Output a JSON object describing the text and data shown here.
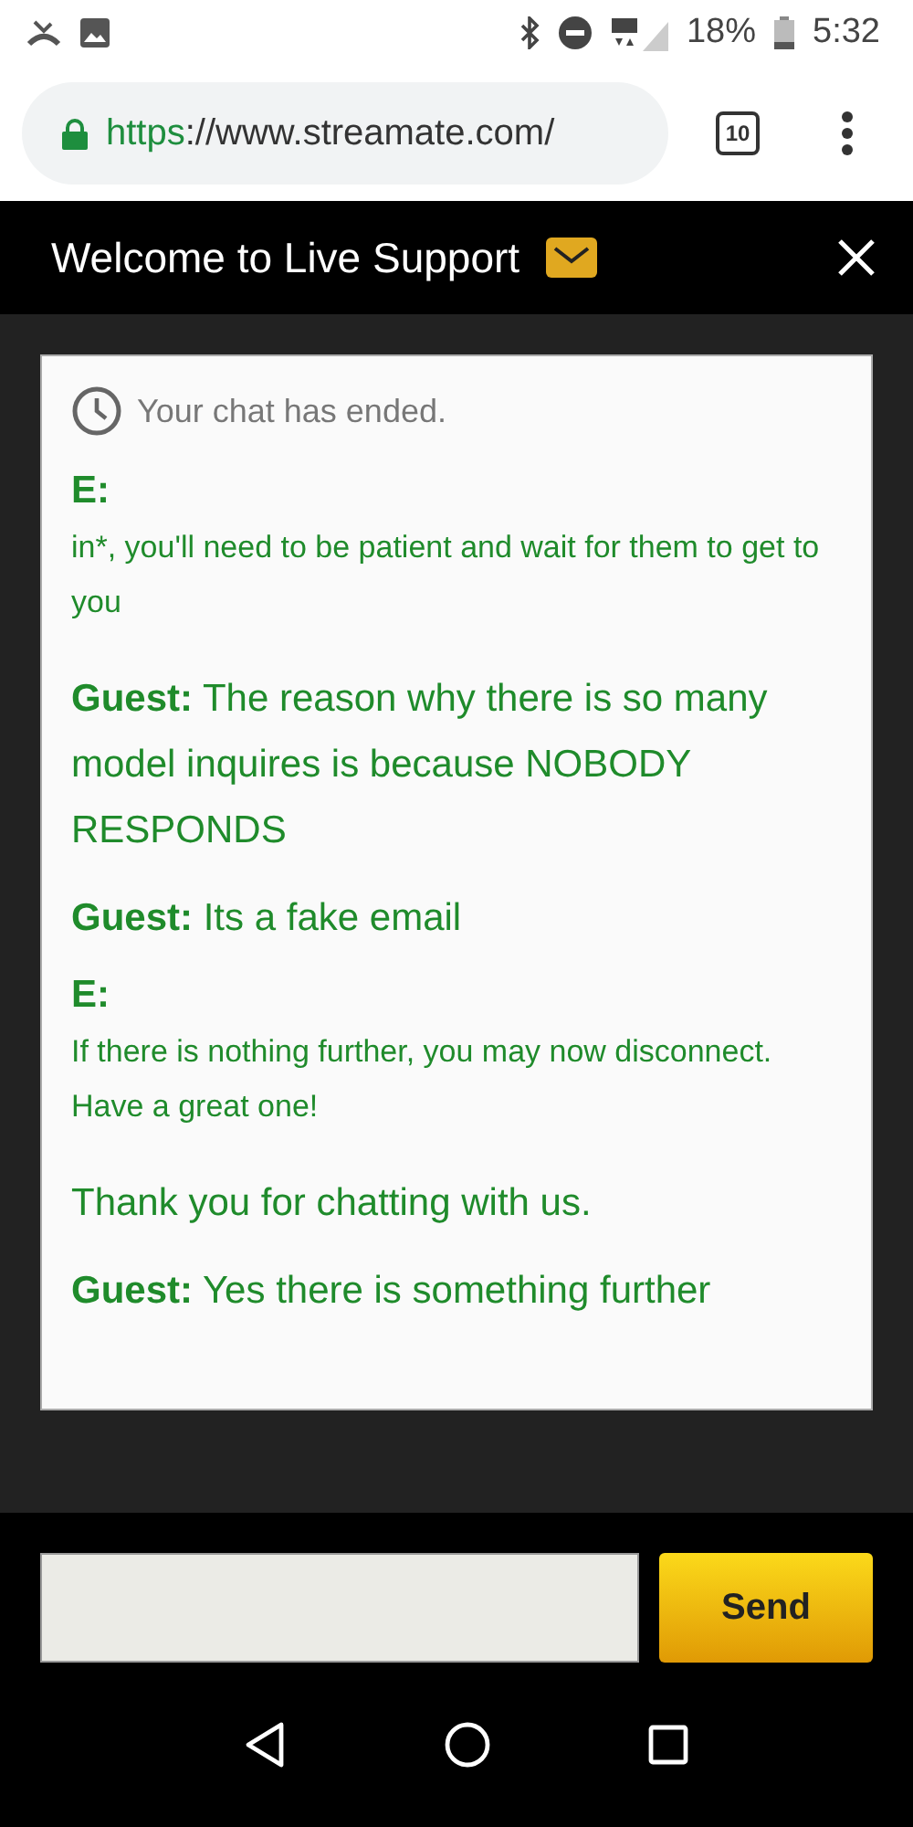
{
  "status_bar": {
    "battery": "18%",
    "time": "5:32"
  },
  "browser": {
    "url_scheme": "https",
    "url_rest": "://www.streamate.com/",
    "tab_count": "10"
  },
  "chat": {
    "title": "Welcome to Live Support",
    "messages": [
      {
        "kind": "system",
        "text": "Your chat has ended."
      },
      {
        "kind": "agent",
        "sender": "E:",
        "text": "in*, you'll need to be patient and wait for them to get to you"
      },
      {
        "kind": "guest",
        "sender": "Guest:",
        "text": "The reason why there is so many model inquires is because NOBODY RESPONDS"
      },
      {
        "kind": "guest",
        "sender": "Guest:",
        "text": "Its a fake email"
      },
      {
        "kind": "agent",
        "sender": "E:",
        "text": "If there is nothing further, you may now disconnect. Have a great one!"
      },
      {
        "kind": "notice",
        "text": "Thank you for chatting with us."
      },
      {
        "kind": "guest",
        "sender": "Guest:",
        "text": "Yes there is something further"
      }
    ],
    "send_button": "Send"
  }
}
